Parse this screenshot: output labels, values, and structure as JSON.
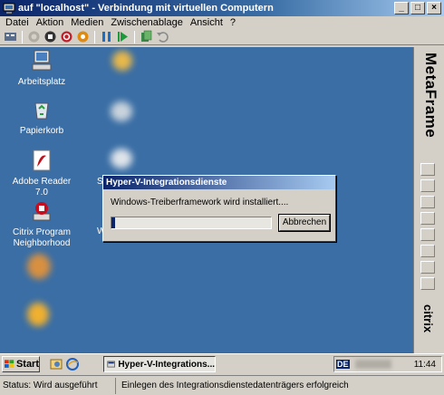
{
  "window": {
    "title": "auf \"localhost\" - Verbindung mit virtuellen Computern",
    "controls": [
      "_",
      "□",
      "×"
    ]
  },
  "menu": [
    "Datei",
    "Aktion",
    "Medien",
    "Zwischenablage",
    "Ansicht",
    "?"
  ],
  "toolbar": [
    "ctrl-alt-del-icon",
    "start-icon",
    "turnoff-icon",
    "shutdown-icon",
    "save-icon",
    "pause-icon",
    "resume-icon",
    "snapshot-icon",
    "revert-icon"
  ],
  "desktop": {
    "icons": [
      {
        "label": "Arbeitsplatz"
      },
      {
        "label": "Papierkorb"
      },
      {
        "label": "Adobe Reader 7.0"
      },
      {
        "label": "Citrix Program Neighborhood"
      }
    ],
    "partial_labels": [
      "S",
      "W"
    ]
  },
  "sidebar": {
    "brand": "MetaFrame",
    "footer": "citrix"
  },
  "dialog": {
    "title": "Hyper-V-Integrationsdienste",
    "message": "Windows-Treiberframework wird installiert....",
    "progress": 0.02,
    "cancel_label": "Abbrechen"
  },
  "taskbar": {
    "start_label": "Start",
    "task_label": "Hyper-V-Integrations...",
    "lang": "DE",
    "clock": "11:44"
  },
  "status": {
    "state": "Status: Wird ausgeführt",
    "message": "Einlegen des Integrationsdienstedatenträgers erfolgreich"
  }
}
